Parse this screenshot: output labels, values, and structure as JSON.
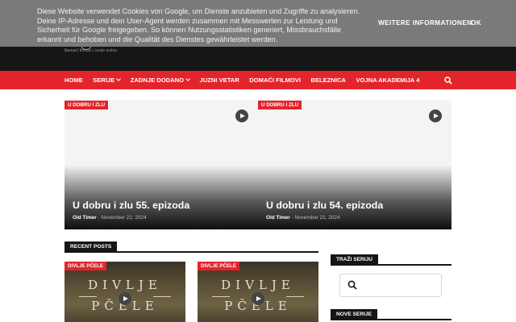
{
  "cookie": {
    "text": "Diese Website verwendet Cookies von Google, um Dienste anzubieten und Zugriffe zu analysieren. Deine IP-Adresse und dein User-Agent werden zusammen mit Messwerten zur Leistung und Sicherheit für Google freigegeben. So können Nutzungsstatistiken generiert, Missbrauchsfälle erkannt und behoben und die Qualität des Dienstes gewährleistet werden.",
    "more_label": "WEITERE INFORMATIONEN",
    "ok_label": "OK"
  },
  "header": {
    "tagline": "Domaći filmovi i serije online"
  },
  "nav": {
    "items": [
      {
        "label": "HOME",
        "dropdown": false
      },
      {
        "label": "SERIJE",
        "dropdown": true
      },
      {
        "label": "ZADNJE DODANO",
        "dropdown": true
      },
      {
        "label": "JUZNI VETAR",
        "dropdown": false
      },
      {
        "label": "DOMAĆI FILMOVI",
        "dropdown": false
      },
      {
        "label": "BELEZNICA",
        "dropdown": false
      },
      {
        "label": "VOJNA AKADEMIJA 4",
        "dropdown": false
      }
    ],
    "search_icon": "search-icon"
  },
  "featured": [
    {
      "tag": "U DOBRU I ZLU",
      "title": "U dobru i zlu 55. epizoda",
      "author": "Old Timer",
      "date": "- November 22, 2024"
    },
    {
      "tag": "U DOBRU I ZLU",
      "title": "U dobru i zlu 54. epizoda",
      "author": "Old Timer",
      "date": "- November 21, 2024"
    }
  ],
  "recent": {
    "heading": "RECENT POSTS",
    "posts": [
      {
        "tag": "DIVLJE PČELE",
        "word1": "DIVLJE",
        "word2": "PČELE"
      },
      {
        "tag": "DIVLJE PČELE",
        "word1": "DIVLJE",
        "word2": "PČELE"
      }
    ]
  },
  "sidebar": {
    "search_heading": "TRAŽI SERIJU",
    "new_heading": "NOVE SERIJE"
  },
  "colors": {
    "accent": "#e3242b",
    "header_bg": "#161616",
    "cookie_bg": "#7a7a7a"
  }
}
